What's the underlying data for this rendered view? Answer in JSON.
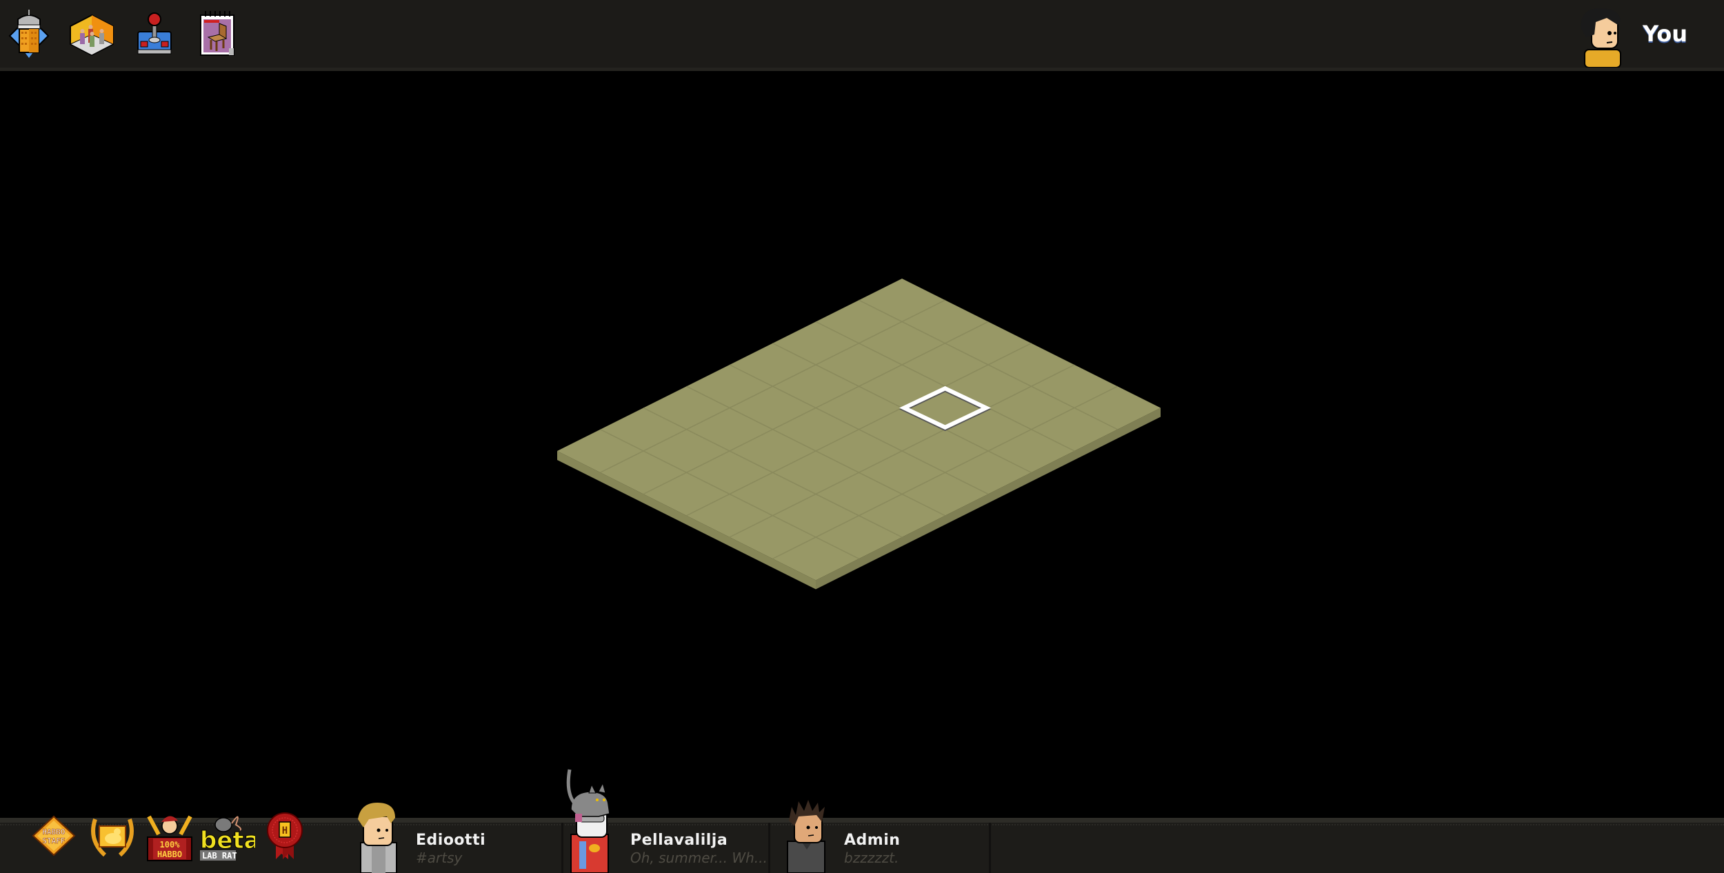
{
  "toolbar": {
    "items": [
      {
        "icon": "hotel-view-icon",
        "label": "Hotel"
      },
      {
        "icon": "rooms-navigator-icon",
        "label": "Rooms"
      },
      {
        "icon": "games-joystick-icon",
        "label": "Games"
      },
      {
        "icon": "catalog-icon",
        "label": "Catalog"
      }
    ]
  },
  "profile": {
    "label": "You",
    "icon": "own-avatar-icon"
  },
  "room": {
    "floor_color": "#989866",
    "floor_side_color": "#7f7f54",
    "grid_columns": 6,
    "grid_rows": 8,
    "selected_tile": {
      "col": 3,
      "row": 2
    }
  },
  "badges": [
    {
      "icon": "habbo-staff-badge",
      "text": "HABBO STAFF"
    },
    {
      "icon": "golden-duck-laurel-badge",
      "text": ""
    },
    {
      "icon": "100-percent-habbo-badge",
      "text": "100% HABBO"
    },
    {
      "icon": "beta-lab-rat-badge",
      "text": "beta LAB RAT"
    },
    {
      "icon": "red-seal-h-badge",
      "text": "H"
    }
  ],
  "users": [
    {
      "name": "Ediootti",
      "motto": "#artsy"
    },
    {
      "name": "Pellavalilja",
      "motto": "Oh, summer... Wh..."
    },
    {
      "name": "Admin",
      "motto": "bzzzzzt."
    }
  ]
}
